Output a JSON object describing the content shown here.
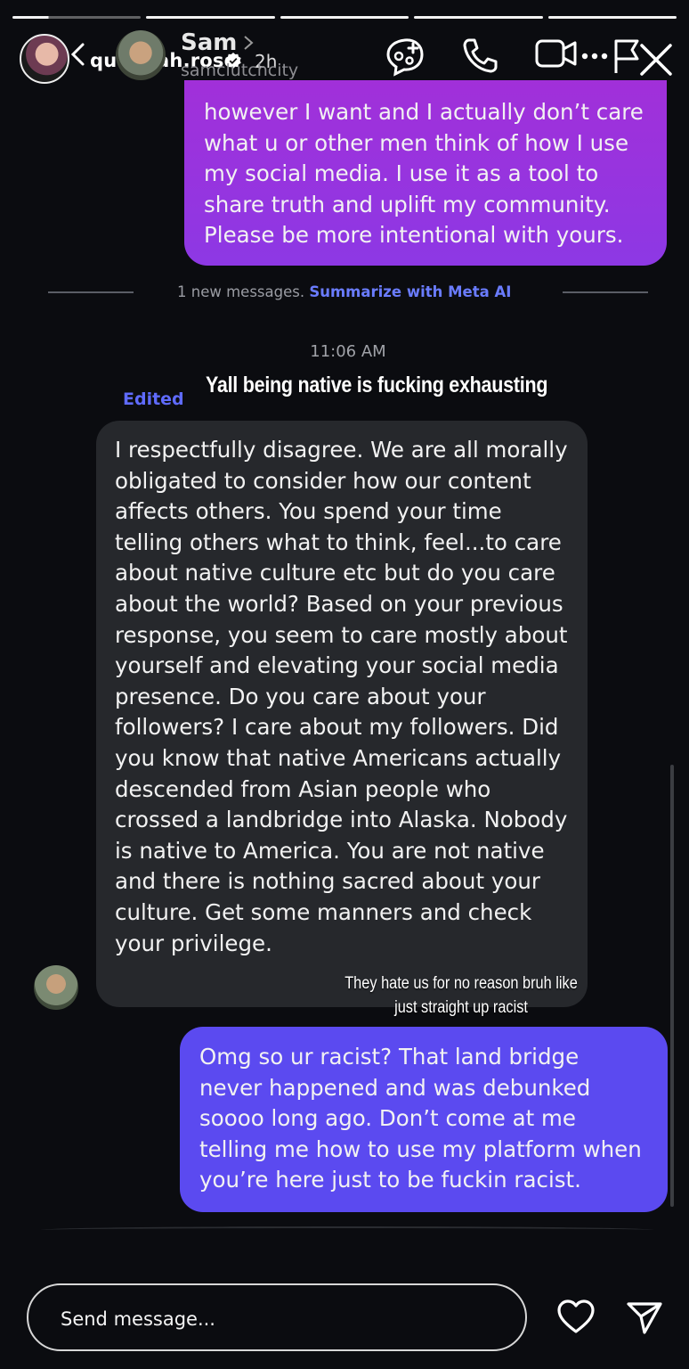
{
  "story": {
    "username": "quannah.rose",
    "verified": true,
    "time": "2h",
    "progress_segments": [
      {
        "filled": 0.28
      },
      {
        "filled": 1
      },
      {
        "filled": 1
      },
      {
        "filled": 1
      },
      {
        "filled": 1
      }
    ],
    "caption_top": "Yall being native is fucking exhausting",
    "caption_bottom": "They hate us for no reason bruh like just straight up racist"
  },
  "dm_header": {
    "name": "Sam",
    "handle": "samclutchcity",
    "icons": [
      "summary-icon",
      "phone-icon",
      "video-icon",
      "more-icon",
      "flag-icon",
      "close-icon"
    ]
  },
  "messages": [
    {
      "direction": "outgoing",
      "text": "however I want and I actually don’t care what u or other men think of how I use my social media. I use it as a tool to share truth and uplift my community. Please be more intentional with yours."
    },
    {
      "direction": "incoming",
      "text": "I respectfully disagree. We are all morally obligated to consider how our content affects others. You spend your time telling others what to think, feel...to care about native culture etc but do you care about the world? Based on your previous response, you seem to care mostly about yourself and elevating your social media presence. Do you care about your followers? I care about my followers. Did you know that native Americans actually descended from Asian people who crossed a landbridge into Alaska. Nobody is native to America. You are not native and there is nothing sacred about your culture. Get some manners and check your privilege."
    },
    {
      "direction": "outgoing",
      "text": "Omg so ur racist? That land bridge never happened and was debunked soooo long ago. Don’t come at me telling me how to use my platform when you’re here just to be fuckin racist."
    }
  ],
  "divider": {
    "text": "1 new messages. ",
    "link": "Summarize with Meta AI"
  },
  "timestamp": "11:06 AM",
  "edited_label": "Edited",
  "footer": {
    "placeholder": "Send message..."
  },
  "colors": {
    "background": "#0b0c10",
    "outgoing_1": "#a130d9",
    "outgoing_2": "#5b4af0",
    "incoming": "#26282c",
    "accent_link": "#6a7cff"
  }
}
